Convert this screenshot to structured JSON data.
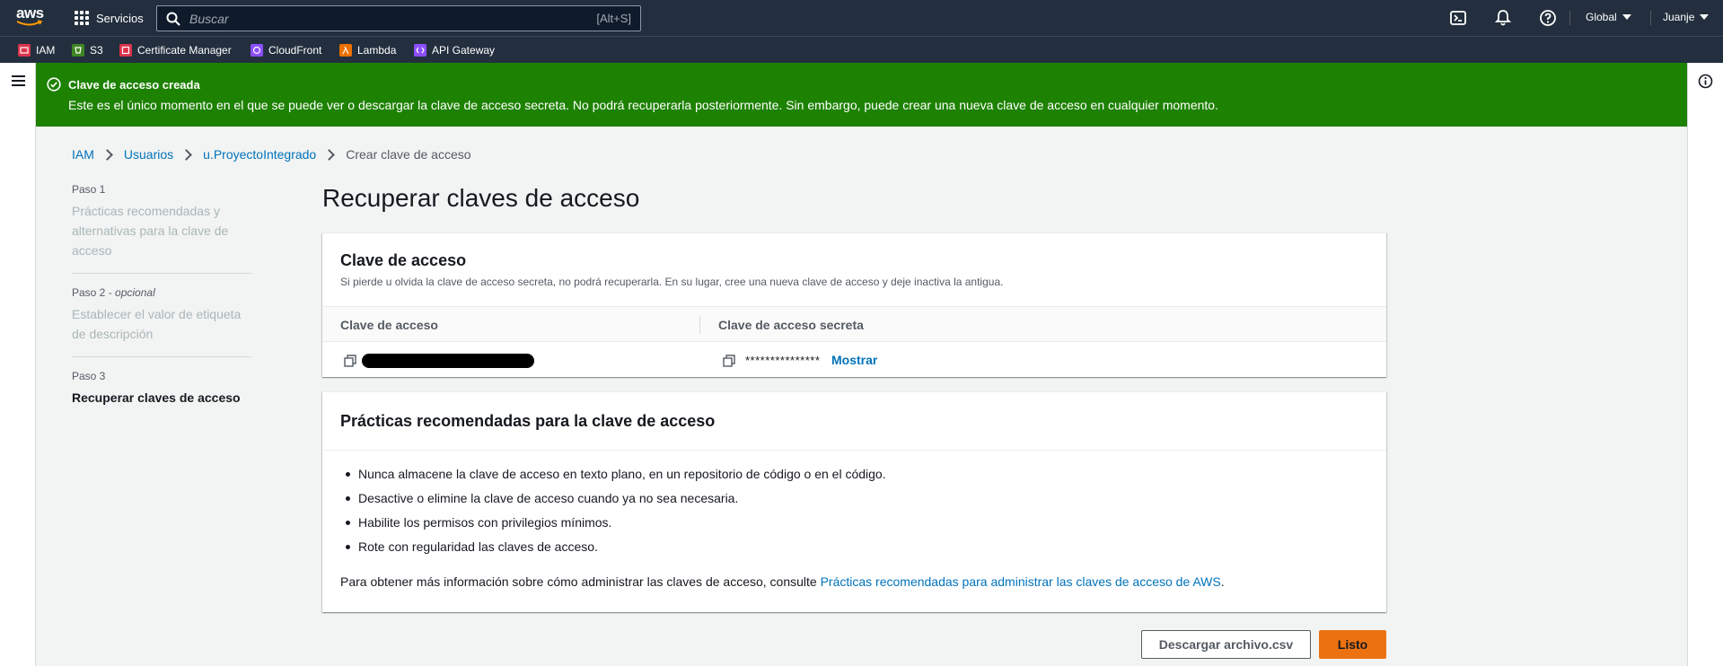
{
  "topbar": {
    "logo_text": "aws",
    "services_label": "Servicios",
    "search_placeholder": "Buscar",
    "search_shortcut": "[Alt+S]",
    "region_label": "Global",
    "user_label": "Juanje"
  },
  "favorites": [
    {
      "label": "IAM",
      "color": "#dd344c"
    },
    {
      "label": "S3",
      "color": "#3f8624"
    },
    {
      "label": "Certificate Manager",
      "color": "#dd344c"
    },
    {
      "label": "CloudFront",
      "color": "#8c4fff"
    },
    {
      "label": "Lambda",
      "color": "#ed7100"
    },
    {
      "label": "API Gateway",
      "color": "#8c4fff"
    }
  ],
  "flash": {
    "title": "Clave de acceso creada",
    "message": "Este es el único momento en el que se puede ver o descargar la clave de acceso secreta. No podrá recuperarla posteriormente. Sin embargo, puede crear una nueva clave de acceso en cualquier momento.",
    "color": "#1d8102"
  },
  "breadcrumb": {
    "items": [
      "IAM",
      "Usuarios",
      "u.ProyectoIntegrado"
    ],
    "current": "Crear clave de acceso"
  },
  "steps": [
    {
      "num": "Paso 1",
      "optional": "",
      "label": "Prácticas recomendadas y alternativas para la clave de acceso"
    },
    {
      "num": "Paso 2 - ",
      "optional": "opcional",
      "label": "Establecer el valor de etiqueta de descripción"
    },
    {
      "num": "Paso 3",
      "optional": "",
      "label": "Recuperar claves de acceso"
    }
  ],
  "page_title": "Recuperar claves de acceso",
  "access_key_card": {
    "title": "Clave de acceso",
    "description": "Si pierde u olvida la clave de acceso secreta, no podrá recuperarla. En su lugar, cree una nueva clave de acceso y deje inactiva la antigua.",
    "col_access_key": "Clave de acceso",
    "col_secret_key": "Clave de acceso secreta",
    "secret_masked": "***************",
    "show_label": "Mostrar"
  },
  "best_practices_card": {
    "title": "Prácticas recomendadas para la clave de acceso",
    "items": [
      "Nunca almacene la clave de acceso en texto plano, en un repositorio de código o en el código.",
      "Desactive o elimine la clave de acceso cuando ya no sea necesaria.",
      "Habilite los permisos con privilegios mínimos.",
      "Rote con regularidad las claves de acceso."
    ],
    "more_prefix": "Para obtener más información sobre cómo administrar las claves de acceso, consulte ",
    "more_link": "Prácticas recomendadas para administrar las claves de acceso de AWS",
    "more_suffix": "."
  },
  "actions": {
    "download_label": "Descargar archivo.csv",
    "done_label": "Listo",
    "primary_color": "#ec7211"
  }
}
